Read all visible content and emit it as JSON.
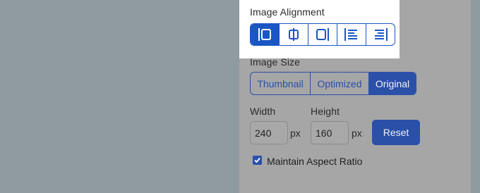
{
  "image_alignment": {
    "label": "Image Alignment",
    "options": [
      {
        "icon": "align-left-icon",
        "active": true
      },
      {
        "icon": "align-center-icon",
        "active": false
      },
      {
        "icon": "align-right-icon",
        "active": false
      },
      {
        "icon": "float-left-icon",
        "active": false
      },
      {
        "icon": "float-right-icon",
        "active": false
      }
    ]
  },
  "image_size": {
    "label": "Image Size",
    "options": [
      {
        "label": "Thumbnail",
        "active": false
      },
      {
        "label": "Optimized",
        "active": false
      },
      {
        "label": "Original",
        "active": true
      }
    ]
  },
  "dimensions": {
    "width_label": "Width",
    "width_value": "240",
    "width_unit": "px",
    "height_label": "Height",
    "height_value": "160",
    "height_unit": "px",
    "reset_label": "Reset"
  },
  "aspect_ratio": {
    "label": "Maintain Aspect Ratio",
    "checked": true
  },
  "colors": {
    "accent": "#1a56c4",
    "accent_dim": "#2a50a8",
    "overlay": "#8f9aa1",
    "panel": "#a6a6a6"
  }
}
